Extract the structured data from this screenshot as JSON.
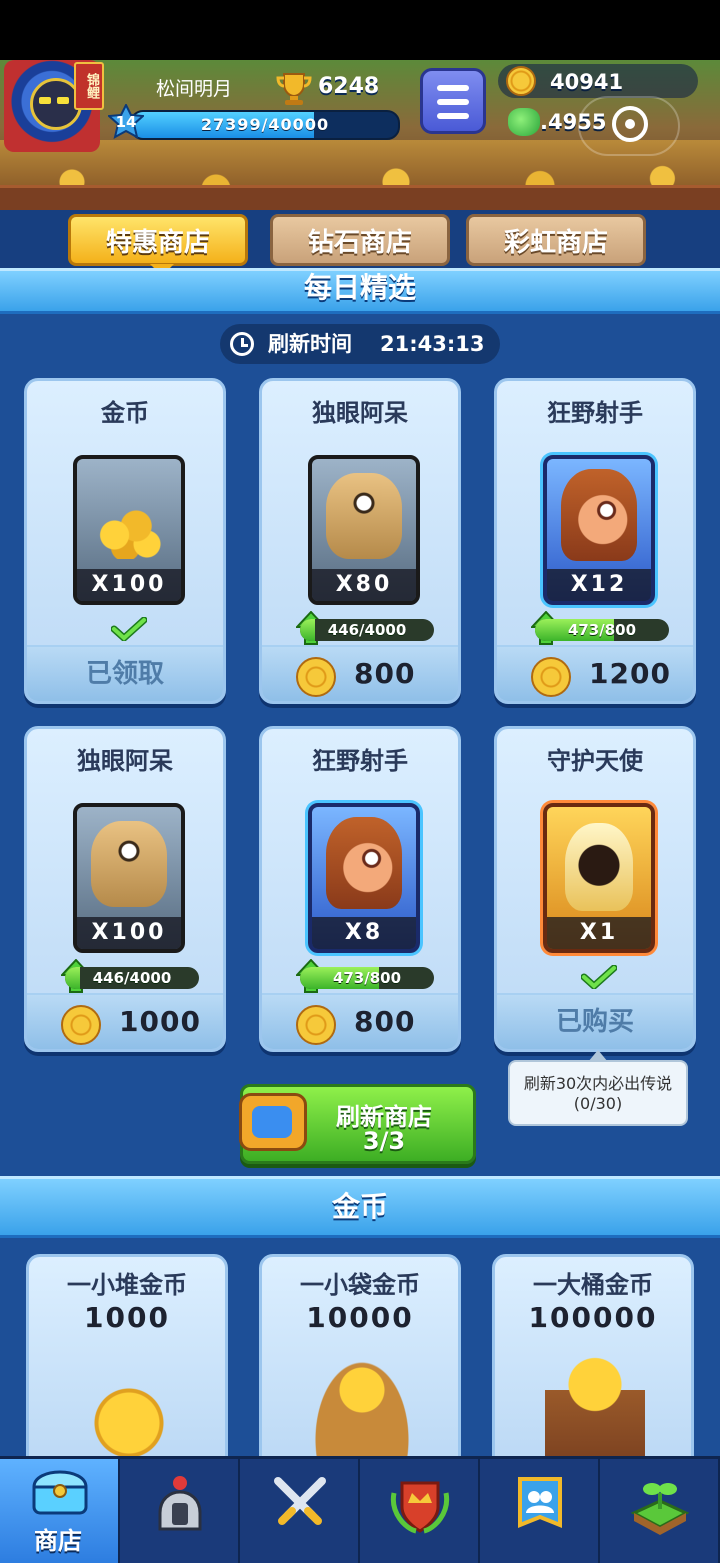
{
  "header": {
    "player_name": "松间明月",
    "trophies": "6248",
    "level": "14",
    "xp_text": "27399/40000",
    "xp_fraction": 0.685,
    "gold": "40941",
    "gems": ".4955",
    "avatar_badge": "锦鲤"
  },
  "tabs": [
    {
      "label": "特惠商店",
      "active": true
    },
    {
      "label": "钻石商店",
      "active": false
    },
    {
      "label": "彩虹商店",
      "active": false
    }
  ],
  "daily": {
    "section_title": "每日精选",
    "refresh_label": "刷新时间",
    "refresh_time": "21:43:13"
  },
  "offers": [
    {
      "title": "金币",
      "qty": "X100",
      "status": "已领取",
      "price": ""
    },
    {
      "title": "独眼阿呆",
      "qty": "X80",
      "progress": "446/4000",
      "progress_fraction": 0.1115,
      "price": "800"
    },
    {
      "title": "狂野射手",
      "qty": "X12",
      "progress": "473/800",
      "progress_fraction": 0.591,
      "price": "1200"
    },
    {
      "title": "独眼阿呆",
      "qty": "X100",
      "progress": "446/4000",
      "progress_fraction": 0.1115,
      "price": "1000"
    },
    {
      "title": "狂野射手",
      "qty": "X8",
      "progress": "473/800",
      "progress_fraction": 0.591,
      "price": "800"
    },
    {
      "title": "守护天使",
      "qty": "X1",
      "status": "已购买",
      "price": ""
    }
  ],
  "tooltip": {
    "line1": "刷新30次内必出传说",
    "line2": "(0/30)"
  },
  "refresh_button": {
    "label": "刷新商店",
    "count": "3/3"
  },
  "gold_section": {
    "title": "金币",
    "packs": [
      {
        "name": "一小堆金币",
        "amount": "1000"
      },
      {
        "name": "一小袋金币",
        "amount": "10000"
      },
      {
        "name": "一大桶金币",
        "amount": "100000"
      }
    ]
  },
  "nav": [
    {
      "label": "商店",
      "icon": "shop-chest-icon",
      "active": true
    },
    {
      "label": "",
      "icon": "knight-helmet-icon",
      "active": false
    },
    {
      "label": "",
      "icon": "crossed-swords-icon",
      "active": false
    },
    {
      "label": "",
      "icon": "crown-shield-icon",
      "active": false
    },
    {
      "label": "",
      "icon": "guild-banner-icon",
      "active": false
    },
    {
      "label": "",
      "icon": "sprout-island-icon",
      "active": false
    }
  ]
}
